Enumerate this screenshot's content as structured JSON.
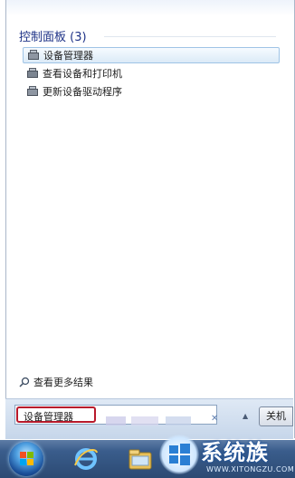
{
  "results": {
    "group_title": "控制面板 (3)",
    "items": [
      {
        "label": "设备管理器",
        "icon": "device-manager-icon",
        "selected": true
      },
      {
        "label": "查看设备和打印机",
        "icon": "printer-icon",
        "selected": false
      },
      {
        "label": "更新设备驱动程序",
        "icon": "driver-update-icon",
        "selected": false
      }
    ],
    "see_more": "查看更多结果"
  },
  "search": {
    "value": "设备管理器"
  },
  "shutdown": {
    "label": "关机"
  },
  "watermark": {
    "brand": "系统族",
    "url": "WWW.XITONGZU.COM"
  },
  "colors": {
    "group_title": "#1e3287",
    "search_highlight": "#b8192b",
    "selection_border": "#9fc4e6",
    "taskbar": "#2c4a73"
  }
}
